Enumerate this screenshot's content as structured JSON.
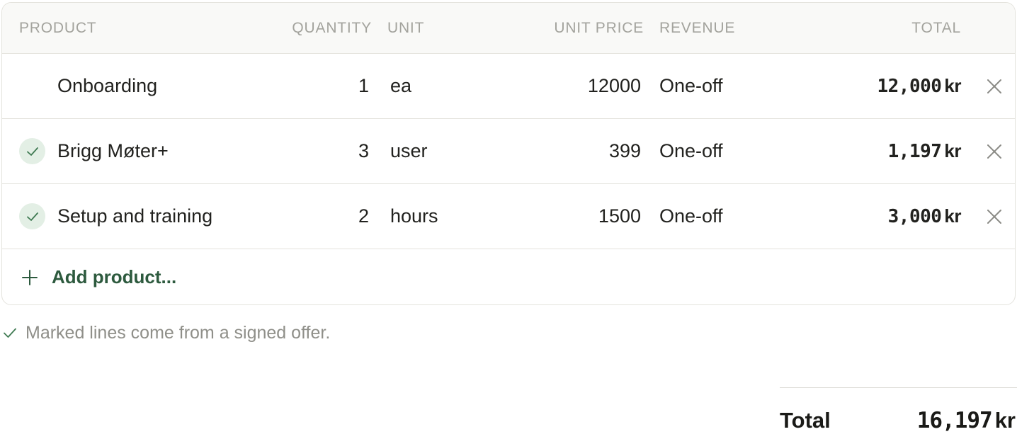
{
  "table": {
    "headers": {
      "product": "PRODUCT",
      "quantity": "QUANTITY",
      "unit": "UNIT",
      "unit_price": "UNIT PRICE",
      "revenue": "REVENUE",
      "total": "TOTAL"
    },
    "rows": [
      {
        "product": "Onboarding",
        "quantity": "1",
        "unit": "ea",
        "unit_price": "12000",
        "revenue": "One-off",
        "total": "12,000",
        "currency": "kr",
        "from_signed_offer": false
      },
      {
        "product": "Brigg Møter+",
        "quantity": "3",
        "unit": "user",
        "unit_price": "399",
        "revenue": "One-off",
        "total": "1,197",
        "currency": "kr",
        "from_signed_offer": true
      },
      {
        "product": "Setup and training",
        "quantity": "2",
        "unit": "hours",
        "unit_price": "1500",
        "revenue": "One-off",
        "total": "3,000",
        "currency": "kr",
        "from_signed_offer": true
      }
    ],
    "add_product_label": "Add product..."
  },
  "note": {
    "text": "Marked lines come from a signed offer."
  },
  "summary": {
    "label": "Total",
    "value": "16,197",
    "currency": "kr"
  },
  "icons": {
    "check": "check-icon",
    "remove": "close-icon",
    "add": "plus-icon"
  },
  "colors": {
    "accent": "#2d5a3e",
    "check_badge_bg": "#e3efe5",
    "check_stroke": "#3f7a52",
    "header_bg": "#f9f9f7",
    "border": "#e4e3dd",
    "muted_text": "#8f8f89"
  }
}
